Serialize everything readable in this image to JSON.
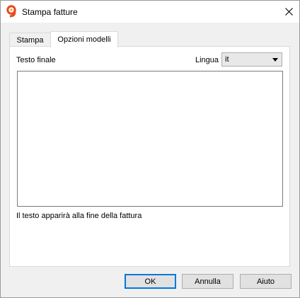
{
  "window": {
    "title": "Stampa fatture",
    "icon": "banana-app-icon"
  },
  "tabs": [
    {
      "label": "Stampa",
      "active": false
    },
    {
      "label": "Opzioni modelli",
      "active": true
    }
  ],
  "panel": {
    "text_label": "Testo finale",
    "language_label": "Lingua",
    "language_value": "it",
    "textarea_value": "",
    "hint": "Il testo apparirà alla fine della fattura"
  },
  "buttons": {
    "ok": "OK",
    "cancel": "Annulla",
    "help": "Aiuto"
  },
  "colors": {
    "accent": "#0078d7",
    "brand": "#e8471c"
  }
}
